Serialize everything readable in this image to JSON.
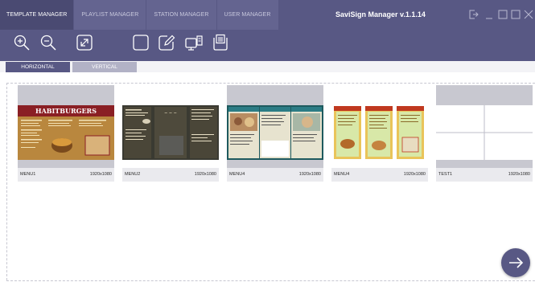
{
  "app": {
    "title": "SaviSign Manager v.1.1.14"
  },
  "nav_tabs": [
    {
      "label": "TEMPLATE MANAGER",
      "active": true
    },
    {
      "label": "PLAYLIST MANAGER",
      "active": false
    },
    {
      "label": "STATION MANAGER",
      "active": false
    },
    {
      "label": "USER MANAGER",
      "active": false
    }
  ],
  "toolbar": {
    "icons": [
      "zoom-in-icon",
      "zoom-out-icon",
      "fit-screen-icon",
      "new-template-icon",
      "edit-template-icon",
      "preview-icon",
      "delete-icon"
    ]
  },
  "orientation": {
    "horizontal_label": "HORIZONTAL",
    "vertical_label": "VERTICAL",
    "selected": "HORIZONTAL"
  },
  "templates": [
    {
      "name": "MENU1",
      "resolution": "1920x1080",
      "thumb_title": "HABITBURGERS"
    },
    {
      "name": "MENU2",
      "resolution": "1920x1080",
      "thumb_title": ""
    },
    {
      "name": "MENU4",
      "resolution": "1920x1080",
      "thumb_title": ""
    },
    {
      "name": "MENU4",
      "resolution": "1920x1080",
      "thumb_title": ""
    },
    {
      "name": "TEST1",
      "resolution": "1920x1080",
      "thumb_title": ""
    }
  ],
  "colors": {
    "header": "#585884",
    "active_tab": "#4a4a72",
    "accent_fab": "#585884",
    "card_bg": "#eaeaee"
  },
  "fab": {
    "icon": "arrow-right-icon"
  }
}
